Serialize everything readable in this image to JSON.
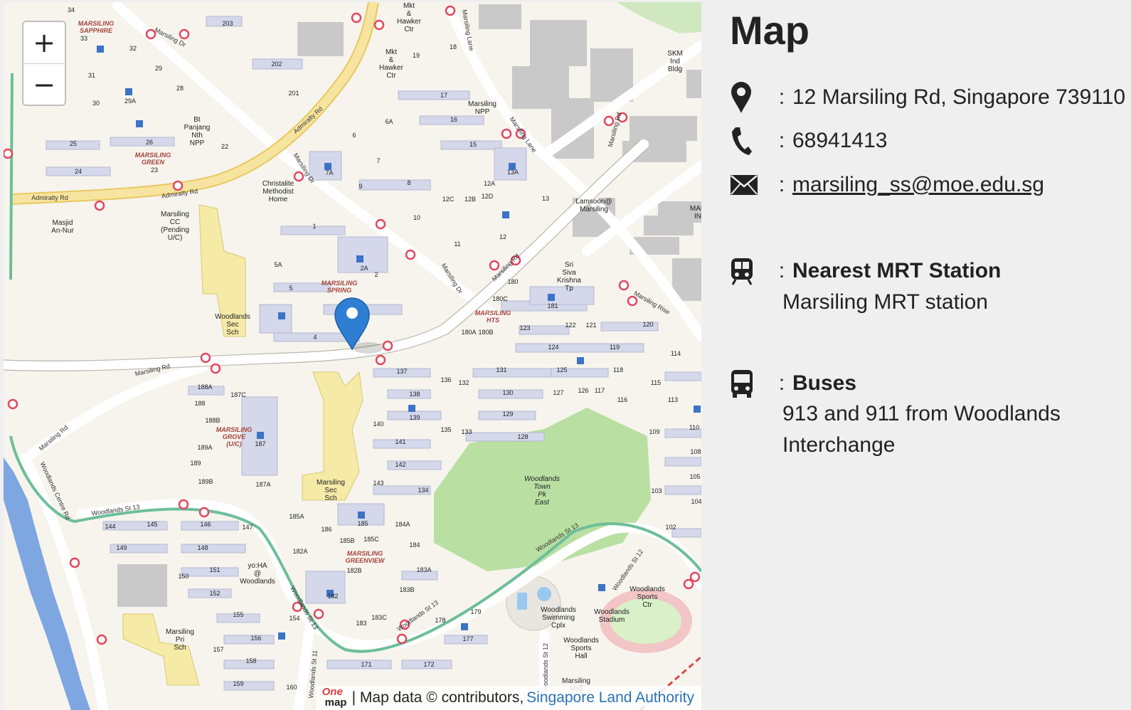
{
  "map": {
    "zoom_in": "+",
    "zoom_out": "−",
    "attribution_prefix": "| Map data © contributors,",
    "attribution_link": "Singapore Land Authority",
    "logo_top": "One",
    "logo_bottom": "map",
    "roads": [
      "Admiralty Rd",
      "Admiralty Rd",
      "Admiralty Rd",
      "Marsiling Dr",
      "Marsiling Dr",
      "Marsiling Dr",
      "Marsiling Rd",
      "Marsiling Rd",
      "Marsiling Rd",
      "Marsiling Lane",
      "Marsiling Lane",
      "Marsiling Rd",
      "Marsiling Rise",
      "Woodlands Centre Rd",
      "Woodlands St 13",
      "Woodlands St 13",
      "Woodlands St 13",
      "Woodlands St 13",
      "Woodlands St 12",
      "Woodlands St 11",
      "Woodlands St 12"
    ],
    "places": [
      "MARSILING SAPPHIRE",
      "MARSILING GREEN",
      "MARSILING SPRING",
      "MARSILING HTS",
      "MARSILING GROVE (U/C)",
      "MARSILING GREENVIEW",
      "Woodlands Sec Sch",
      "Marsiling Sec Sch",
      "Marsiling Pri Sch",
      "Woodlands Town Pk East",
      "Woodlands Swimming Cplx",
      "Woodlands Stadium",
      "Woodlands Sports Ctr",
      "Woodlands Sports Hall",
      "Christalite Methodist Home",
      "Marsiling CC (Pending U/C)",
      "Masjid An-Nur",
      "Bt Panjang Nth NPP",
      "Marsiling NPP",
      "Mkt & Hawker Ctr",
      "Mkt & Hawker Ctr",
      "SKM Ind Bldg",
      "Lamsoon@ Marsiling",
      "Sri Siva Krishna Tp",
      "yo:HA @ Woodlands",
      "Marsiling Mall",
      "MAR IN"
    ],
    "blocks": [
      "34",
      "33",
      "32",
      "31",
      "30",
      "29",
      "29A",
      "28",
      "203",
      "202",
      "201",
      "26",
      "25",
      "24",
      "23",
      "22",
      "6",
      "6A",
      "7",
      "7A",
      "8",
      "9",
      "10",
      "11",
      "12",
      "12A",
      "12B",
      "12C",
      "12D",
      "13",
      "13A",
      "15",
      "16",
      "17",
      "18",
      "19",
      "1",
      "2",
      "2A",
      "4",
      "5",
      "5A",
      "180",
      "180A",
      "180B",
      "180C",
      "181",
      "120",
      "119",
      "121",
      "122",
      "123",
      "124",
      "125",
      "126",
      "127",
      "117",
      "116",
      "118",
      "115",
      "114",
      "113",
      "110",
      "109",
      "108",
      "105",
      "104",
      "103",
      "102",
      "131",
      "130",
      "129",
      "128",
      "132",
      "133",
      "134",
      "135",
      "136",
      "137",
      "138",
      "139",
      "140",
      "141",
      "142",
      "143",
      "184A",
      "184",
      "183A",
      "183B",
      "183C",
      "183",
      "185",
      "185A",
      "185B",
      "185C",
      "186",
      "182",
      "182A",
      "182B",
      "187",
      "187A",
      "187C",
      "188",
      "188A",
      "188B",
      "189",
      "189A",
      "189B",
      "144",
      "145",
      "146",
      "147",
      "148",
      "149",
      "150",
      "151",
      "152",
      "154",
      "155",
      "156",
      "157",
      "158",
      "159",
      "160",
      "171",
      "172",
      "177",
      "178",
      "179"
    ]
  },
  "panel": {
    "title": "Map",
    "address": "12 Marsiling Rd, Singapore 739110",
    "phone": "68941413",
    "email": "marsiling_ss@moe.edu.sg",
    "mrt_heading": "Nearest MRT Station",
    "mrt_value": "Marsiling MRT station",
    "bus_heading": "Buses",
    "bus_value": "913 and 911 from Woodlands Interchange",
    "colon": ":"
  },
  "colors": {
    "map_bg": "#f7f4ee",
    "road_yellow": "#f2dc8e",
    "park_green": "#b9dfa3",
    "block_blue": "#d4d8ea",
    "school_yellow": "#f5eba7",
    "water_blue": "#7ea6e0",
    "rail_green": "#6dbe9a",
    "marker_blue": "#2e7fd4",
    "bus_stop_red": "#e0485e"
  }
}
